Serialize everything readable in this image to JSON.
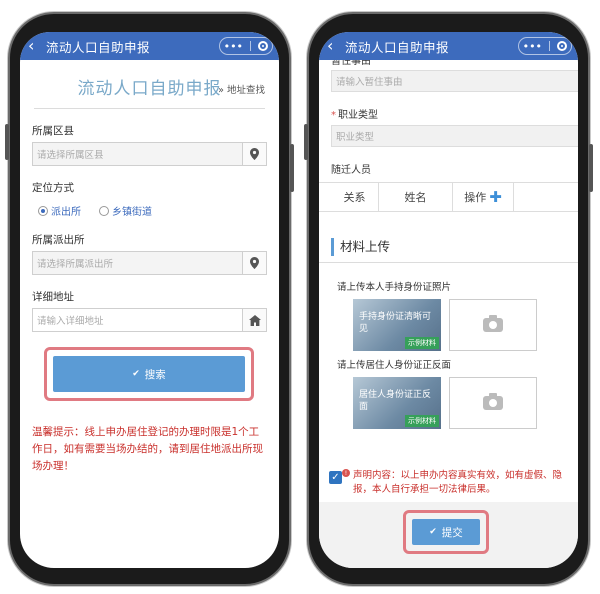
{
  "app": {
    "title": "流动人口自助申报",
    "back_glyph": "‹",
    "more_glyph": "•••"
  },
  "left": {
    "header_title": "流动人口自助申报",
    "header_link": "» 地址查找",
    "district": {
      "label": "所属区县",
      "placeholder": "请选择所属区县"
    },
    "locate": {
      "label": "定位方式",
      "options": [
        "派出所",
        "乡镇街道"
      ],
      "selected": "派出所"
    },
    "station": {
      "label": "所属派出所",
      "placeholder": "请选择所属派出所"
    },
    "address": {
      "label": "详细地址",
      "placeholder": "请输入详细地址"
    },
    "search_label": "搜索",
    "tip": "温馨提示：线上申办居住登记的办理时限是1个工作日，如有需要当场办结的，请到居住地派出所现场办理！"
  },
  "right": {
    "reason": {
      "label": "暂住事由",
      "placeholder": "请输入暂住事由"
    },
    "job": {
      "required_mark": "*",
      "label": "职业类型",
      "placeholder": "职业类型"
    },
    "companions": {
      "label": "随迁人员",
      "columns": [
        "关系",
        "姓名",
        "操作"
      ]
    },
    "section_title": "材料上传",
    "upload1": {
      "label": "请上传本人手持身份证照片",
      "sample_caption": "手持身份证清晰可见",
      "sample_tag": "示例材料"
    },
    "upload2": {
      "label": "请上传居住人身份证正反面",
      "sample_caption": "居住人身份证正反面",
      "sample_tag": "示例材料"
    },
    "declaration": "声明内容：以上申办内容真实有效，如有虚假、隐报，本人自行承担一切法律后果。",
    "submit_label": "提交"
  },
  "colors": {
    "nav": "#3d6bbd",
    "button": "#5b9bd5",
    "highlight": "#e07a82",
    "warning": "#c9302c"
  }
}
